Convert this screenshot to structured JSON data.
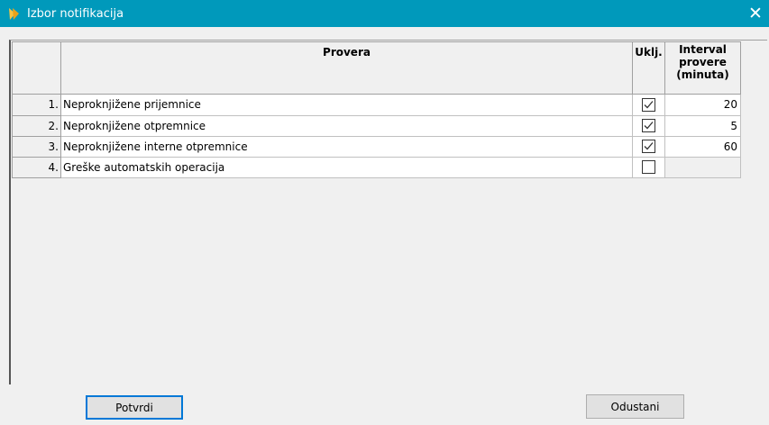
{
  "window": {
    "title": "Izbor notifikacija",
    "close_label": "✕",
    "titlebar_color": "#0099bb"
  },
  "grid": {
    "columns": {
      "provera": "Provera",
      "uklj": "Uklj.",
      "interval": [
        "Interval",
        "provere",
        "(minuta)"
      ]
    },
    "rows": [
      {
        "num": "1.",
        "name": "Neproknjižene prijemnice",
        "checked": true,
        "interval": "20"
      },
      {
        "num": "2.",
        "name": "Neproknjižene otpremnice",
        "checked": true,
        "interval": "5"
      },
      {
        "num": "3.",
        "name": "Neproknjižene interne otpremnice",
        "checked": true,
        "interval": "60"
      },
      {
        "num": "4.",
        "name": "Greške automatskih operacija",
        "checked": false,
        "interval": ""
      }
    ]
  },
  "buttons": {
    "ok": "Potvrdi",
    "cancel": "Odustani"
  }
}
